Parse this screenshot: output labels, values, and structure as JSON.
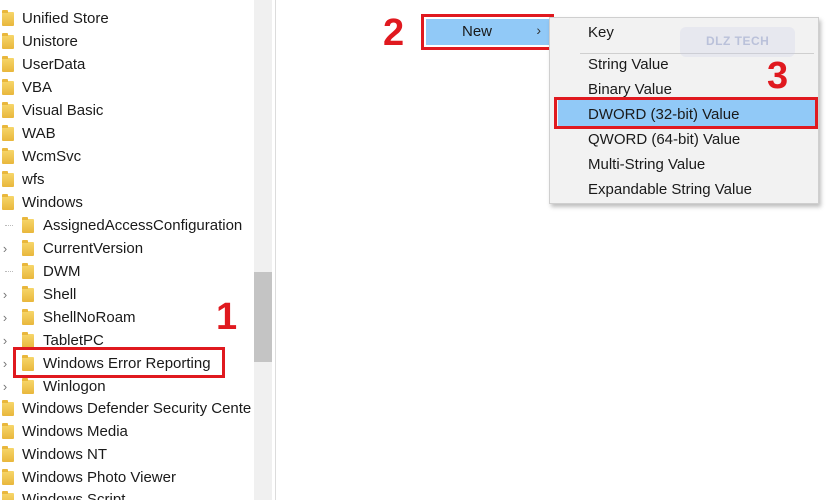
{
  "tree": {
    "items": [
      {
        "label": "Unified Store",
        "level": 0
      },
      {
        "label": "Unistore",
        "level": 0
      },
      {
        "label": "UserData",
        "level": 0
      },
      {
        "label": "VBA",
        "level": 0
      },
      {
        "label": "Visual Basic",
        "level": 0
      },
      {
        "label": "WAB",
        "level": 0
      },
      {
        "label": "WcmSvc",
        "level": 0
      },
      {
        "label": "wfs",
        "level": 0
      },
      {
        "label": "Windows",
        "level": 0
      },
      {
        "label": "AssignedAccessConfiguration",
        "level": 1,
        "expandable": false
      },
      {
        "label": "CurrentVersion",
        "level": 1,
        "expandable": true
      },
      {
        "label": "DWM",
        "level": 1,
        "expandable": false
      },
      {
        "label": "Shell",
        "level": 1,
        "expandable": true
      },
      {
        "label": "ShellNoRoam",
        "level": 1,
        "expandable": true
      },
      {
        "label": "TabletPC",
        "level": 1,
        "expandable": true
      },
      {
        "label": "Windows Error Reporting",
        "level": 1,
        "expandable": true,
        "selected": true
      },
      {
        "label": "Winlogon",
        "level": 1,
        "expandable": true
      },
      {
        "label": "Windows Defender Security Cente",
        "level": 0
      },
      {
        "label": "Windows Media",
        "level": 0
      },
      {
        "label": "Windows NT",
        "level": 0
      },
      {
        "label": "Windows Photo Viewer",
        "level": 0
      },
      {
        "label": "Windows Script",
        "level": 0
      }
    ]
  },
  "context_menu": {
    "new_label": "New",
    "arrow": "›"
  },
  "submenu": {
    "items": [
      "Key",
      "String Value",
      "Binary Value",
      "DWORD (32-bit) Value",
      "QWORD (64-bit) Value",
      "Multi-String Value",
      "Expandable String Value"
    ],
    "highlighted_index": 3
  },
  "steps": {
    "one": "1",
    "two": "2",
    "three": "3"
  },
  "watermark": "DLZ TECH",
  "colors": {
    "highlight": "#91c9f7",
    "annotation_red": "#e0191f",
    "folder": "#f0c54f"
  }
}
